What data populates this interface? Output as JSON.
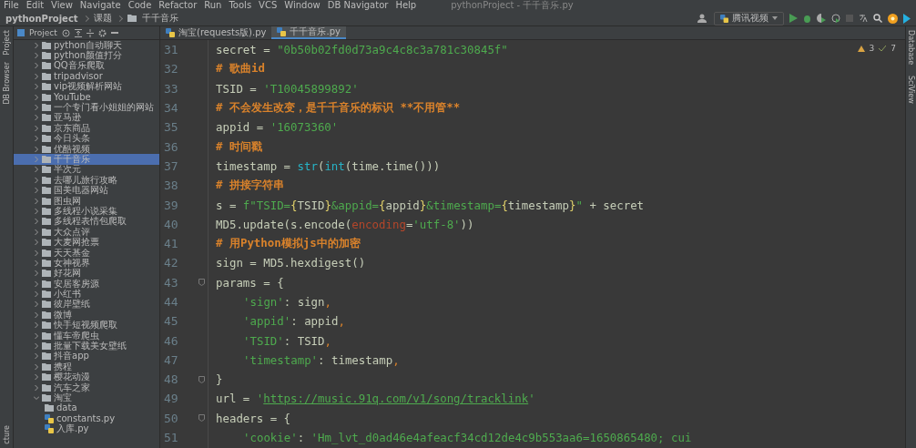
{
  "menu_bar": {
    "items": [
      "File",
      "Edit",
      "View",
      "Navigate",
      "Code",
      "Refactor",
      "Run",
      "Tools",
      "VCS",
      "Window",
      "DB Navigator",
      "Help"
    ],
    "title": "pythonProject - 千千音乐.py"
  },
  "breadcrumb": [
    "pythonProject",
    "课题",
    "千千音乐"
  ],
  "toolbar": {
    "run_config": "腾讯视频"
  },
  "left_strip": [
    "Project",
    "DB Browser",
    "cture"
  ],
  "right_strip": [
    "Database",
    "SciView"
  ],
  "project_panel": {
    "title": "Project",
    "items": [
      {
        "kind": "folder",
        "label": "python自动聊天",
        "selected": false,
        "expanded": false
      },
      {
        "kind": "folder",
        "label": "python颜值打分",
        "selected": false,
        "expanded": false
      },
      {
        "kind": "folder",
        "label": "QQ音乐爬取",
        "selected": false,
        "expanded": false
      },
      {
        "kind": "folder",
        "label": "tripadvisor",
        "selected": false,
        "expanded": false
      },
      {
        "kind": "folder",
        "label": "vip视频解析网站",
        "selected": false,
        "expanded": false
      },
      {
        "kind": "folder",
        "label": "YouTube",
        "selected": false,
        "expanded": false
      },
      {
        "kind": "folder",
        "label": "一个专门看小姐姐的网站",
        "selected": false,
        "expanded": false
      },
      {
        "kind": "folder",
        "label": "亚马逊",
        "selected": false,
        "expanded": false
      },
      {
        "kind": "folder",
        "label": "京东商品",
        "selected": false,
        "expanded": false
      },
      {
        "kind": "folder",
        "label": "今日头条",
        "selected": false,
        "expanded": false
      },
      {
        "kind": "folder",
        "label": "优酷视频",
        "selected": false,
        "expanded": false
      },
      {
        "kind": "folder",
        "label": "千千音乐",
        "selected": true,
        "expanded": false
      },
      {
        "kind": "folder",
        "label": "半次元",
        "selected": false,
        "expanded": false
      },
      {
        "kind": "folder",
        "label": "去哪儿旅行攻略",
        "selected": false,
        "expanded": false
      },
      {
        "kind": "folder",
        "label": "国美电器网站",
        "selected": false,
        "expanded": false
      },
      {
        "kind": "folder",
        "label": "图虫网",
        "selected": false,
        "expanded": false
      },
      {
        "kind": "folder",
        "label": "多线程小说采集",
        "selected": false,
        "expanded": false
      },
      {
        "kind": "folder",
        "label": "多线程表情包爬取",
        "selected": false,
        "expanded": false
      },
      {
        "kind": "folder",
        "label": "大众点评",
        "selected": false,
        "expanded": false
      },
      {
        "kind": "folder",
        "label": "大麦网抢票",
        "selected": false,
        "expanded": false
      },
      {
        "kind": "folder",
        "label": "天天基金",
        "selected": false,
        "expanded": false
      },
      {
        "kind": "folder",
        "label": "女神视界",
        "selected": false,
        "expanded": false
      },
      {
        "kind": "folder",
        "label": "好花网",
        "selected": false,
        "expanded": false
      },
      {
        "kind": "folder",
        "label": "安居客房源",
        "selected": false,
        "expanded": false
      },
      {
        "kind": "folder",
        "label": "小红书",
        "selected": false,
        "expanded": false
      },
      {
        "kind": "folder",
        "label": "彼岸壁纸",
        "selected": false,
        "expanded": false
      },
      {
        "kind": "folder",
        "label": "微博",
        "selected": false,
        "expanded": false
      },
      {
        "kind": "folder",
        "label": "快手短视频爬取",
        "selected": false,
        "expanded": false
      },
      {
        "kind": "folder",
        "label": "懂车帝爬虫",
        "selected": false,
        "expanded": false
      },
      {
        "kind": "folder",
        "label": "批量下载美女壁纸",
        "selected": false,
        "expanded": false
      },
      {
        "kind": "folder",
        "label": "抖音app",
        "selected": false,
        "expanded": false
      },
      {
        "kind": "folder",
        "label": "携程",
        "selected": false,
        "expanded": false
      },
      {
        "kind": "folder",
        "label": "樱花动漫",
        "selected": false,
        "expanded": false
      },
      {
        "kind": "folder",
        "label": "汽车之家",
        "selected": false,
        "expanded": false
      },
      {
        "kind": "folder",
        "label": "淘宝",
        "selected": false,
        "expanded": true,
        "children": [
          {
            "kind": "folder",
            "label": "data",
            "selected": false,
            "expanded": false
          },
          {
            "kind": "file",
            "label": "constants.py",
            "selected": false
          },
          {
            "kind": "file",
            "label": "入库.py",
            "selected": false
          }
        ]
      }
    ]
  },
  "tabs": [
    {
      "label": "淘宝(requests版).py",
      "selected": false
    },
    {
      "label": "千千音乐.py",
      "selected": true
    }
  ],
  "inspections": {
    "warnings": "3",
    "weak_warnings": "7"
  },
  "code_lines": [
    {
      "number": "31",
      "fold": false,
      "tokens": [
        {
          "kind": "plain",
          "text": "secret = "
        },
        {
          "kind": "string",
          "text": "\"0b50b02fd0d73a9c4c8c3a781c30845f\""
        }
      ]
    },
    {
      "number": "32",
      "fold": false,
      "tokens": [
        {
          "kind": "comment",
          "text": "# 歌曲id"
        }
      ]
    },
    {
      "number": "33",
      "fold": false,
      "tokens": [
        {
          "kind": "plain",
          "text": "TSID = "
        },
        {
          "kind": "string",
          "text": "'T10045899892'"
        }
      ]
    },
    {
      "number": "34",
      "fold": false,
      "tokens": [
        {
          "kind": "comment",
          "text": "# 不会发生改变，是千千音乐的标识 **不用管**"
        }
      ]
    },
    {
      "number": "35",
      "fold": false,
      "tokens": [
        {
          "kind": "plain",
          "text": "appid = "
        },
        {
          "kind": "string",
          "text": "'16073360'"
        }
      ]
    },
    {
      "number": "36",
      "fold": false,
      "tokens": [
        {
          "kind": "comment",
          "text": "# 时间戳"
        }
      ]
    },
    {
      "number": "37",
      "fold": false,
      "tokens": [
        {
          "kind": "plain",
          "text": "timestamp = "
        },
        {
          "kind": "builtin",
          "text": "str"
        },
        {
          "kind": "plain",
          "text": "("
        },
        {
          "kind": "builtin",
          "text": "int"
        },
        {
          "kind": "plain",
          "text": "(time.time()))"
        }
      ]
    },
    {
      "number": "38",
      "fold": false,
      "tokens": [
        {
          "kind": "comment",
          "text": "# 拼接字符串"
        }
      ]
    },
    {
      "number": "39",
      "fold": false,
      "tokens": [
        {
          "kind": "plain",
          "text": "s = "
        },
        {
          "kind": "string",
          "text": "f\"TSID="
        },
        {
          "kind": "brace",
          "text": "{"
        },
        {
          "kind": "plain",
          "text": "TSID"
        },
        {
          "kind": "brace",
          "text": "}"
        },
        {
          "kind": "string",
          "text": "&appid="
        },
        {
          "kind": "brace",
          "text": "{"
        },
        {
          "kind": "plain",
          "text": "appid"
        },
        {
          "kind": "brace",
          "text": "}"
        },
        {
          "kind": "string",
          "text": "&timestamp="
        },
        {
          "kind": "brace",
          "text": "{"
        },
        {
          "kind": "plain",
          "text": "timestamp"
        },
        {
          "kind": "brace",
          "text": "}"
        },
        {
          "kind": "string",
          "text": "\""
        },
        {
          "kind": "plain",
          "text": " + secret"
        }
      ]
    },
    {
      "number": "40",
      "fold": false,
      "tokens": [
        {
          "kind": "plain",
          "text": "MD5.update(s.encode("
        },
        {
          "kind": "param",
          "text": "encoding"
        },
        {
          "kind": "plain",
          "text": "="
        },
        {
          "kind": "string",
          "text": "'utf-8'"
        },
        {
          "kind": "plain",
          "text": "))"
        }
      ]
    },
    {
      "number": "41",
      "fold": false,
      "tokens": [
        {
          "kind": "comment",
          "text": "# 用Python模拟js中的加密"
        }
      ]
    },
    {
      "number": "42",
      "fold": false,
      "tokens": [
        {
          "kind": "plain",
          "text": "sign = MD5.hexdigest()"
        }
      ]
    },
    {
      "number": "43",
      "fold": true,
      "tokens": [
        {
          "kind": "plain",
          "text": "params = {"
        }
      ]
    },
    {
      "number": "44",
      "fold": false,
      "indented": true,
      "tokens": [
        {
          "kind": "string",
          "text": "'sign'"
        },
        {
          "kind": "plain",
          "text": ": sign"
        },
        {
          "kind": "punct",
          "text": ","
        }
      ]
    },
    {
      "number": "45",
      "fold": false,
      "indented": true,
      "tokens": [
        {
          "kind": "string",
          "text": "'appid'"
        },
        {
          "kind": "plain",
          "text": ": appid"
        },
        {
          "kind": "punct",
          "text": ","
        }
      ]
    },
    {
      "number": "46",
      "fold": false,
      "indented": true,
      "tokens": [
        {
          "kind": "string",
          "text": "'TSID'"
        },
        {
          "kind": "plain",
          "text": ": TSID"
        },
        {
          "kind": "punct",
          "text": ","
        }
      ]
    },
    {
      "number": "47",
      "fold": false,
      "indented": true,
      "tokens": [
        {
          "kind": "string",
          "text": "'timestamp'"
        },
        {
          "kind": "plain",
          "text": ": timestamp"
        },
        {
          "kind": "punct",
          "text": ","
        }
      ]
    },
    {
      "number": "48",
      "fold": true,
      "tokens": [
        {
          "kind": "plain",
          "text": "}"
        }
      ]
    },
    {
      "number": "49",
      "fold": false,
      "tokens": [
        {
          "kind": "plain",
          "text": "url = "
        },
        {
          "kind": "string",
          "text": "'"
        },
        {
          "kind": "link",
          "text": "https://music.91q.com/v1/song/tracklink"
        },
        {
          "kind": "string",
          "text": "'"
        }
      ]
    },
    {
      "number": "50",
      "fold": true,
      "tokens": [
        {
          "kind": "plain",
          "text": "headers = {"
        }
      ]
    },
    {
      "number": "51",
      "fold": false,
      "indented": true,
      "tokens": [
        {
          "kind": "string",
          "text": "'cookie'"
        },
        {
          "kind": "plain",
          "text": ": "
        },
        {
          "kind": "string",
          "text": "'Hm_lvt_d0ad46e4afeacf34cd12de4c9b553aa6=1650865480; cui"
        }
      ]
    }
  ]
}
